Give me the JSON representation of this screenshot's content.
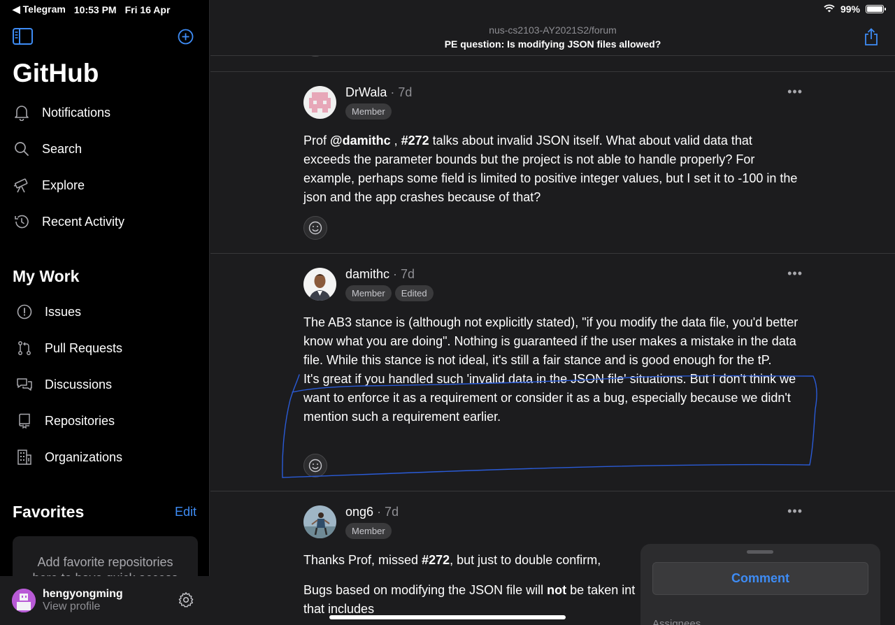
{
  "status_bar": {
    "back_app": "◀ Telegram",
    "time": "10:53 PM",
    "date": "Fri 16 Apr",
    "battery": "99%",
    "battery_level": 0.99
  },
  "sidebar": {
    "app_title": "GitHub",
    "nav": [
      {
        "label": "Notifications",
        "icon": "bell-icon"
      },
      {
        "label": "Search",
        "icon": "search-icon"
      },
      {
        "label": "Explore",
        "icon": "telescope-icon"
      },
      {
        "label": "Recent Activity",
        "icon": "history-icon"
      }
    ],
    "my_work_title": "My Work",
    "my_work": [
      {
        "label": "Issues",
        "icon": "issue-icon"
      },
      {
        "label": "Pull Requests",
        "icon": "pull-request-icon"
      },
      {
        "label": "Discussions",
        "icon": "discussions-icon"
      },
      {
        "label": "Repositories",
        "icon": "repo-icon"
      },
      {
        "label": "Organizations",
        "icon": "organization-icon"
      }
    ],
    "favorites_title": "Favorites",
    "favorites_edit": "Edit",
    "favorites_empty_line1": "Add favorite repositories",
    "favorites_empty_line2": "here to have quick access",
    "profile": {
      "username": "hengyongming",
      "subtitle": "View profile"
    }
  },
  "header": {
    "repo": "nus-cs2103-AY2021S2/forum",
    "title": "PE question: Is modifying JSON files allowed?"
  },
  "comments": [
    {
      "author": "DrWala",
      "ago": "· 7d",
      "badges": [
        "Member"
      ],
      "paragraphs": [
        "Prof @damithc , #272 talks about invalid JSON itself. What about valid data that exceeds the parameter bounds but the project is not able to handle properly? For example, perhaps some field is limited to positive integer values, but I set it to -100 in the json and the app crashes because of that?"
      ],
      "mention": "@damithc",
      "issue_ref": "#272"
    },
    {
      "author": "damithc",
      "ago": "· 7d",
      "badges": [
        "Member",
        "Edited"
      ],
      "paragraphs": [
        "The AB3 stance is (although not explicitly stated), \"if you modify the data file, you'd better know what you are doing\". Nothing is guaranteed if the user makes a mistake in the data file. While this stance is not ideal, it's still a fair stance and is good enough for the tP.",
        "It's great if you handled such 'invalid data in the JSON file' situations. But I don't think we want to enforce it as a requirement or consider it as a bug, especially because we didn't mention such a requirement earlier."
      ]
    },
    {
      "author": "ong6",
      "ago": "· 7d",
      "badges": [
        "Member"
      ],
      "p1_a": "Thanks Prof, missed ",
      "p1_ref": "#272",
      "p1_b": ", but just to double confirm,",
      "p2_a": "Bugs based on modifying the JSON file will ",
      "p2_bold": "not",
      "p2_b": " be taken int",
      "p3": "that includes"
    }
  ],
  "dots_label": "•••",
  "comment_panel": {
    "button": "Comment",
    "next_section": "Assignees"
  },
  "colors": {
    "accent": "#3e8cf5",
    "background": "#1c1c1e",
    "sidebar": "#000000",
    "annotation": "#2a5bd7"
  }
}
